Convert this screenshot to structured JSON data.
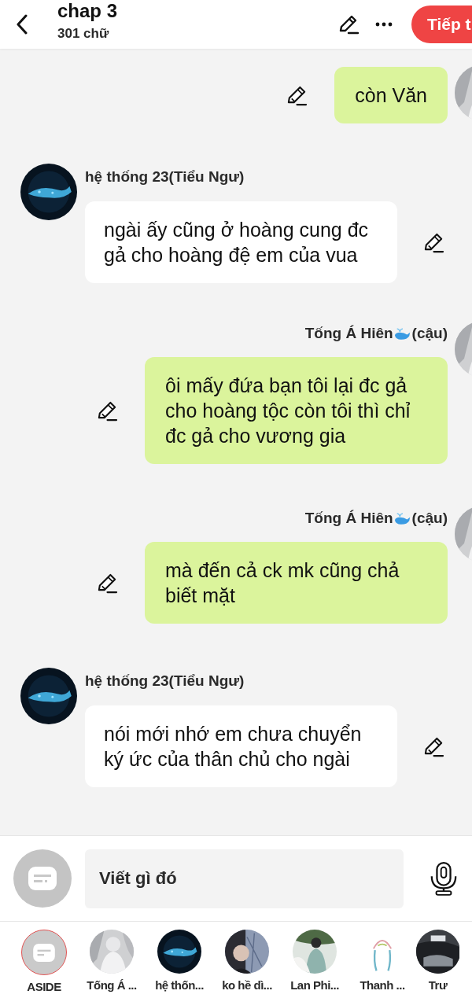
{
  "header": {
    "title": "chap 3",
    "subtitle": "301 chữ",
    "next_button": "Tiếp t"
  },
  "messages": [
    {
      "kind": "right",
      "text": "còn Văn"
    },
    {
      "kind": "left",
      "name": "hệ thống 23(Tiểu Ngư)",
      "text": "ngài ấy cũng ở hoàng cung đc gả cho hoàng đệ em của vua"
    },
    {
      "kind": "right",
      "name": "Tống Á Hiên",
      "name_suffix": "(cậu)",
      "text": "ôi mấy đứa bạn tôi lại đc gả cho hoàng tộc còn tôi thì chỉ đc gả cho vương gia"
    },
    {
      "kind": "right",
      "name": "Tống Á Hiên",
      "name_suffix": "(cậu)",
      "text": "mà đến cả ck mk cũng chả biết mặt"
    },
    {
      "kind": "left",
      "name": "hệ thống 23(Tiểu Ngư)",
      "text": "nói mới nhớ em chưa chuyển ký ức của thân chủ cho ngài"
    }
  ],
  "composer": {
    "placeholder": "Viết gì đó"
  },
  "characters": [
    {
      "kind": "aside",
      "label": "ASIDE"
    },
    {
      "kind": "picture",
      "label": "Tống Á ..."
    },
    {
      "kind": "picture",
      "label": "hệ thốn..."
    },
    {
      "kind": "picture",
      "label": "ko hề dì..."
    },
    {
      "kind": "picture",
      "label": "Lan Phi..."
    },
    {
      "kind": "picture",
      "label": "Thanh ..."
    },
    {
      "kind": "picture",
      "label": "Trư"
    }
  ]
}
